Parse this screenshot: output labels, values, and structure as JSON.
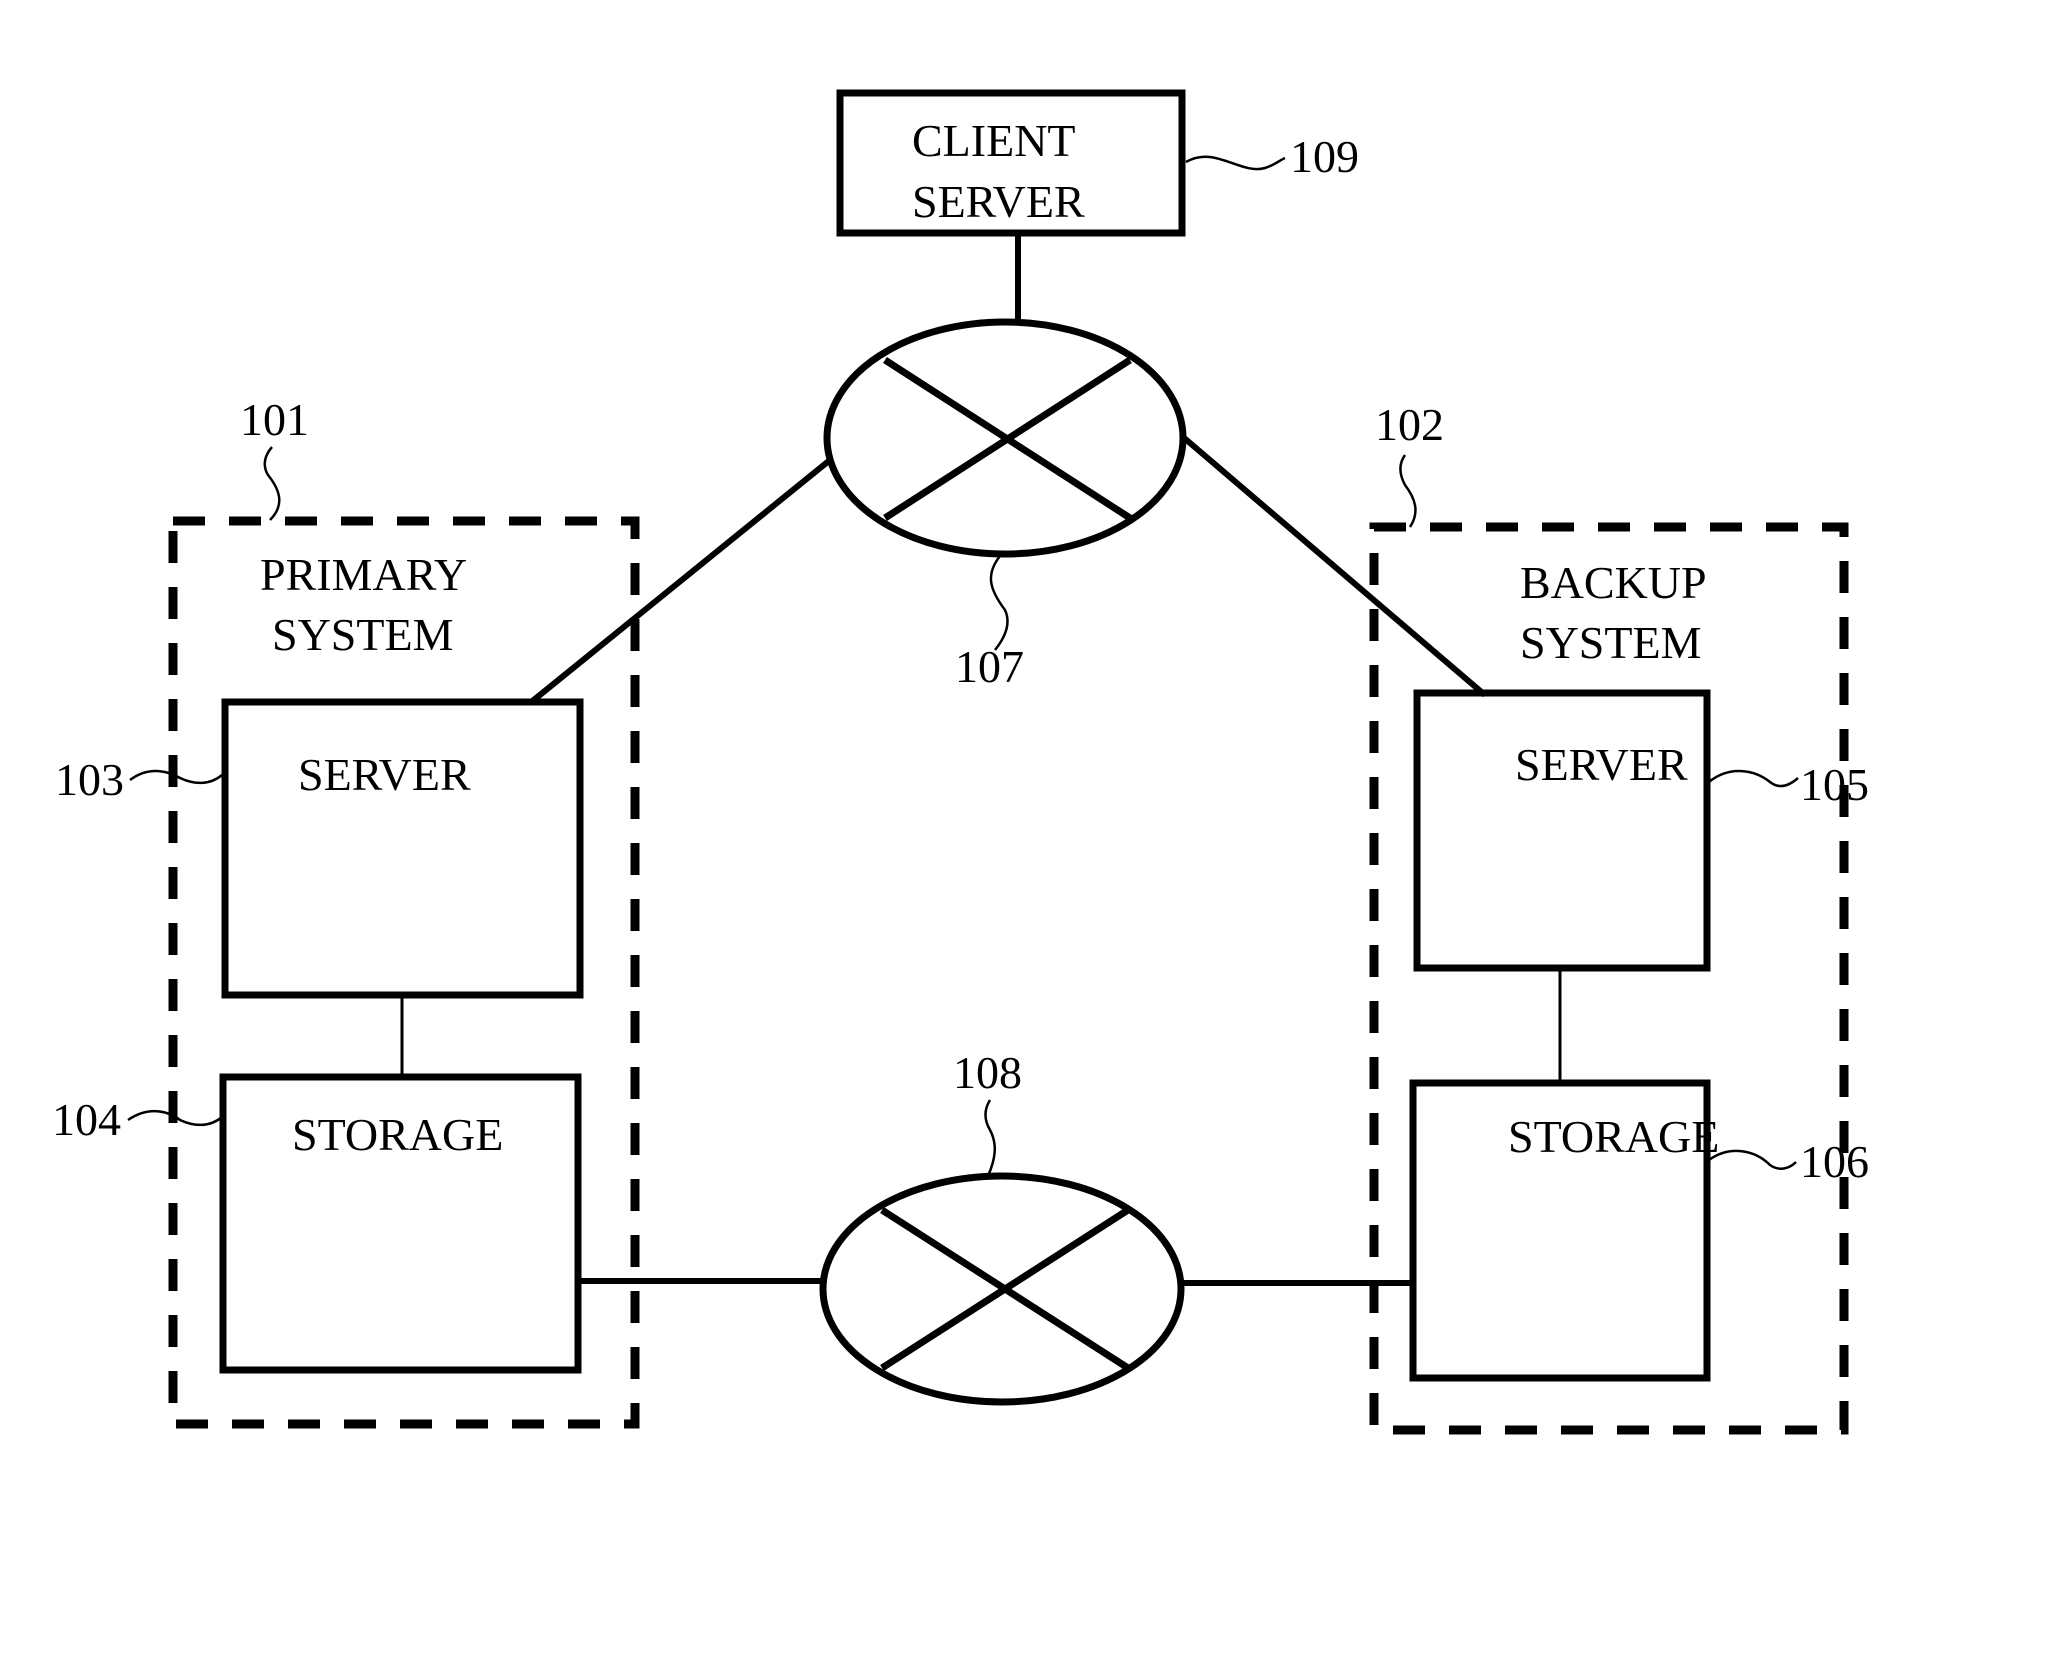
{
  "figure": {
    "client_server": {
      "ref": "109",
      "line1": "CLIENT",
      "line2": "SERVER"
    },
    "network_top": {
      "ref": "107"
    },
    "network_bottom": {
      "ref": "108"
    },
    "primary_system": {
      "ref": "101",
      "line1": "PRIMARY",
      "line2": "SYSTEM",
      "server": {
        "ref": "103",
        "label": "SERVER"
      },
      "storage": {
        "ref": "104",
        "label": "STORAGE"
      }
    },
    "backup_system": {
      "ref": "102",
      "line1": "BACKUP",
      "line2": "SYSTEM",
      "server": {
        "ref": "105",
        "label": "SERVER"
      },
      "storage": {
        "ref": "106",
        "label": "STORAGE"
      }
    },
    "colors": {
      "ink": "#000000",
      "background": "#ffffff"
    }
  }
}
